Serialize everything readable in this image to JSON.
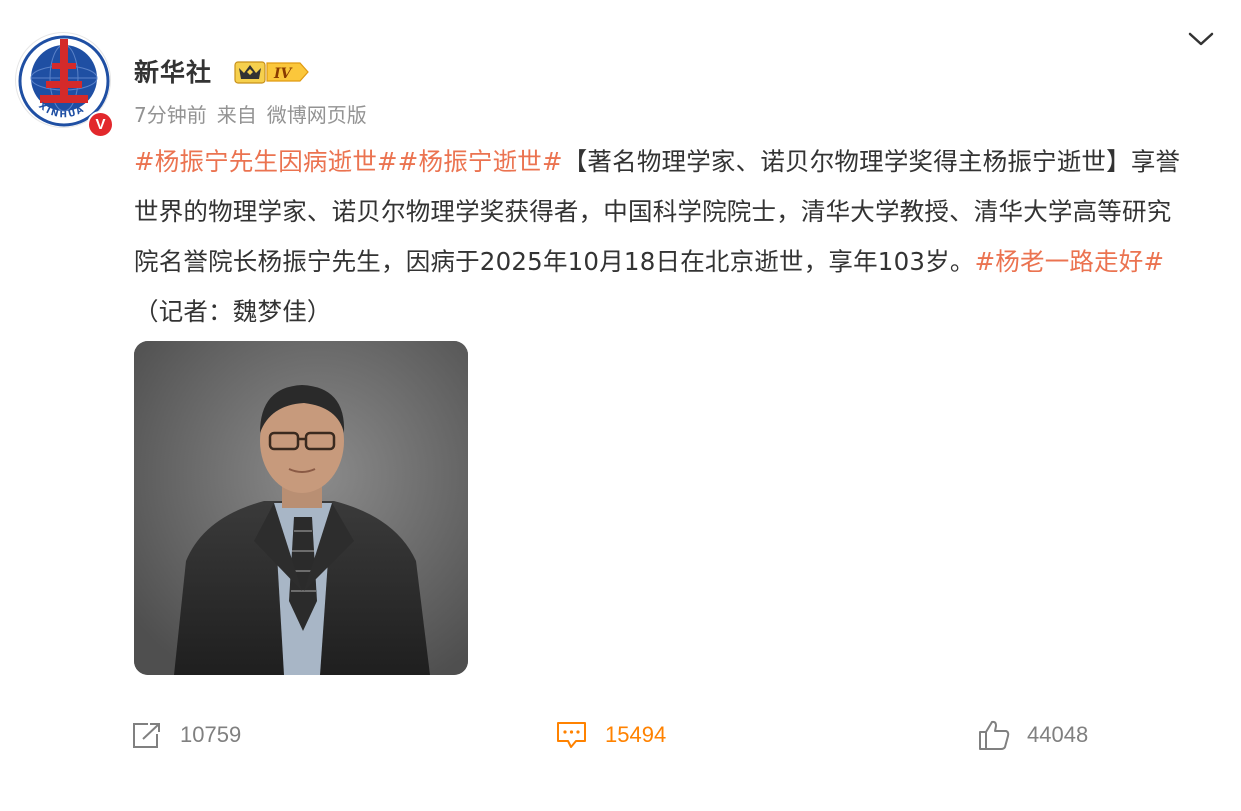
{
  "post": {
    "author": "新华社",
    "level_badge": "IV",
    "avatar_text": "XINHUA",
    "verified_mark": "V",
    "time": "7分钟前",
    "source_prefix": "来自",
    "source": "微博网页版",
    "tag1": "#杨振宁先生因病逝世#",
    "tag2": "#杨振宁逝世#",
    "body": "【著名物理学家、诺贝尔物理学奖得主杨振宁逝世】享誉世界的物理学家、诺贝尔物理学奖获得者，中国科学院院士，清华大学教授、清华大学高等研究院名誉院长杨振宁先生，因病于2025年10月18日在北京逝世，享年103岁。",
    "tag3": "#杨老一路走好#",
    "tail": "（记者：魏梦佳）"
  },
  "actions": {
    "repost_count": "10759",
    "comment_count": "15494",
    "like_count": "44048"
  },
  "colors": {
    "hashtag": "#eb7350",
    "comment_active": "#ff8200",
    "meta_gray": "#939393",
    "verified_red": "#e2282c",
    "logo_blue": "#1f4fa3",
    "logo_red": "#d42a2a"
  },
  "icons": {
    "menu": "chevron-down-icon",
    "repost": "share-external-icon",
    "comment": "comment-bubble-icon",
    "like": "thumbs-up-icon",
    "badge": "crown-icon"
  }
}
